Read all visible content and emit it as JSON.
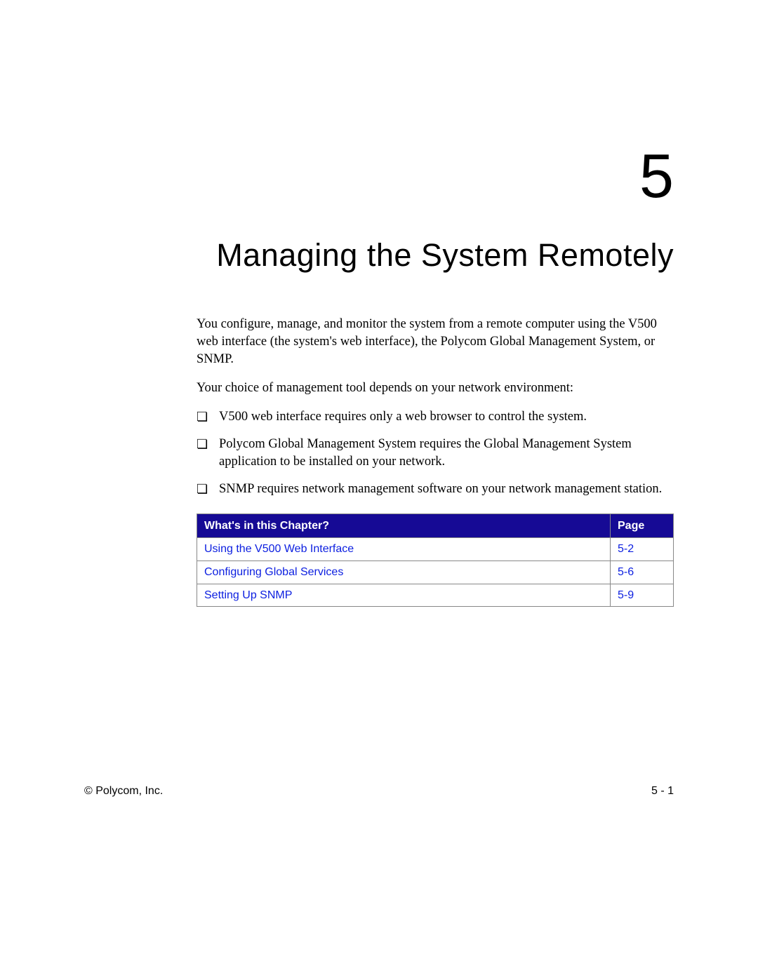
{
  "chapter": {
    "number": "5",
    "title": "Managing the System Remotely"
  },
  "paragraphs": {
    "p1": "You configure, manage, and monitor the system from a remote computer using the V500 web interface (the system's web interface), the Polycom Global Management System, or SNMP.",
    "p2": "Your choice of management tool depends on your network environment:"
  },
  "bullets": {
    "b1": "V500 web interface requires only a web browser to control the system.",
    "b2": "Polycom Global Management System requires the Global Management System application to be installed on your network.",
    "b3": "SNMP requires network management software on your network management station."
  },
  "toc": {
    "header_left": "What's in this Chapter?",
    "header_right": "Page",
    "rows": [
      {
        "title": "Using the V500 Web Interface",
        "page": "5-2"
      },
      {
        "title": "Configuring Global Services",
        "page": "5-6"
      },
      {
        "title": "Setting Up SNMP",
        "page": "5-9"
      }
    ]
  },
  "footer": {
    "left": "© Polycom, Inc.",
    "right": "5 - 1"
  }
}
